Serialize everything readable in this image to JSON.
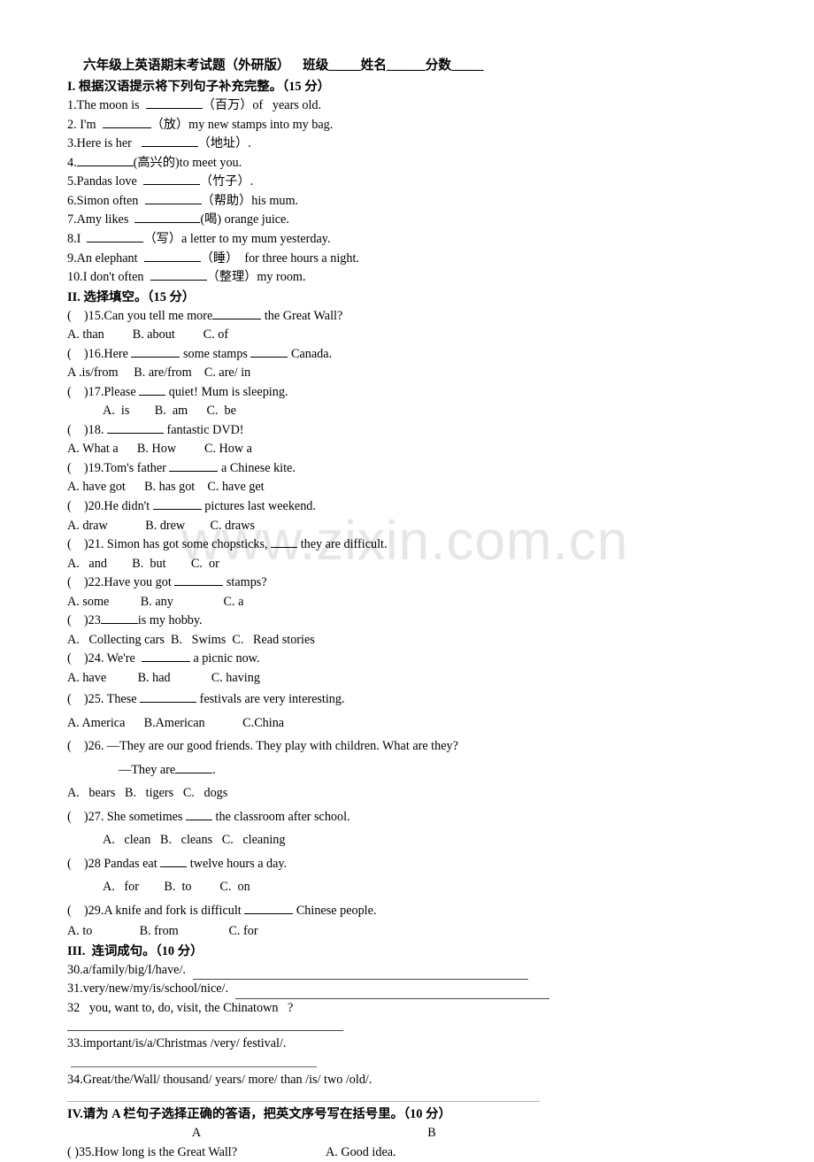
{
  "document": {
    "title": "六年级上英语期末考试题（外研版）    班级_____姓名______分数_____",
    "watermark": "www.zixin.com.cn"
  },
  "section1": {
    "heading": "I. 根据汉语提示将下列句子补充完整。（15 分）",
    "items": [
      {
        "pre": "1.The moon is  ",
        "post": "（百万）of   years old."
      },
      {
        "pre": "2. I'm  ",
        "post": "（放）my new stamps into my bag."
      },
      {
        "pre": "3.Here is her   ",
        "post": "（地址）."
      },
      {
        "pre": "4.",
        "post": "(高兴的)to meet you."
      },
      {
        "pre": "5.Pandas love  ",
        "post": "（竹子）."
      },
      {
        "pre": "6.Simon often  ",
        "post": "（帮助）his mum."
      },
      {
        "pre": "7.Amy likes  ",
        "post": "(喝) orange juice."
      },
      {
        "pre": "8.I  ",
        "post": "（写）a letter to my mum yesterday."
      },
      {
        "pre": "9.An elephant  ",
        "post": "（睡）  for three hours a night."
      },
      {
        "pre": "10.I don't often  ",
        "post": "（整理）my room."
      }
    ]
  },
  "section2": {
    "heading": "II. 选择填空。（15 分）",
    "questions": [
      {
        "stem_pre": "(    )15.Can you tell me more",
        "stem_post": " the Great Wall?",
        "options": "A. than         B. about         C. of"
      },
      {
        "stem_pre": "(    )16.Here ",
        "stem_mid": " some stamps ",
        "stem_post": " Canada.",
        "options": "A .is/from     B. are/from    C. are/ in"
      },
      {
        "stem_pre": "(    )17.Please ",
        "stem_post": " quiet! Mum is sleeping.",
        "options": "A.  is        B.  am      C.  be"
      },
      {
        "stem_pre": "(    )18. ",
        "stem_post": " fantastic DVD!",
        "options": "A. What a      B. How         C. How a"
      },
      {
        "stem_pre": "(    )19.Tom's father ",
        "stem_post": " a Chinese kite.",
        "options": "A. have got      B. has got    C. have get"
      },
      {
        "stem_pre": "(    )20.He didn't ",
        "stem_post": " pictures last weekend.",
        "options": "A. draw            B. drew        C. draws"
      },
      {
        "stem_pre": "(    )21. Simon has got some chopsticks, ",
        "stem_post": " they are difficult.",
        "options": "A.   and        B.  but        C.  or"
      },
      {
        "stem_pre": "(    )22.Have you got ",
        "stem_post": " stamps?",
        "options": "A. some          B. any                C. a"
      },
      {
        "stem_pre": "(    )23",
        "stem_post": "is my hobby.",
        "options": "A.   Collecting cars  B.   Swims  C.   Read stories"
      },
      {
        "stem_pre": "(    )24. We're  ",
        "stem_post": " a picnic now.",
        "options": "A. have          B. had             C. having"
      },
      {
        "stem_pre": "(    )25. These ",
        "stem_post": " festivals are very interesting.",
        "options": "A. America      B.American            C.China"
      },
      {
        "stem_pre": "(    )26. —They are our good friends. They play with children. What are they?",
        "stem_line2_pre": "—They are",
        "stem_line2_post": ".",
        "options": "A.   bears   B.   tigers   C.   dogs"
      },
      {
        "stem_pre": "(    )27. She sometimes ",
        "stem_post": " the classroom after school.",
        "options": "A.   clean   B.   cleans   C.   cleaning"
      },
      {
        "stem_pre": "(    )28 Pandas eat ",
        "stem_post": " twelve hours a day.",
        "options": "A.   for        B.  to         C.  on"
      },
      {
        "stem_pre": "(    )29.A knife and fork is difficult ",
        "stem_post": " Chinese people.",
        "options": "A. to               B. from                C. for"
      }
    ]
  },
  "section3": {
    "heading": "III.  连词成句。（10 分）",
    "items": [
      {
        "text": "30.a/family/big/I/have/."
      },
      {
        "text": "31.very/new/my/is/school/nice/."
      },
      {
        "text": "32   you, want to, do, visit, the Chinatown   ?"
      },
      {
        "text": "33.important/is/a/Christmas /very/ festival/."
      },
      {
        "text": "34.Great/the/Wall/ thousand/ years/ more/ than /is/ two /old/."
      }
    ]
  },
  "section4": {
    "heading": "IV.请为 A 栏句子选择正确的答语，把英文序号写在括号里。（10 分）",
    "col_a_header": "A",
    "col_b_header": "B",
    "rows": [
      {
        "a": "(      )35.How long is the Great Wall?",
        "b": "A. Good idea."
      }
    ]
  }
}
